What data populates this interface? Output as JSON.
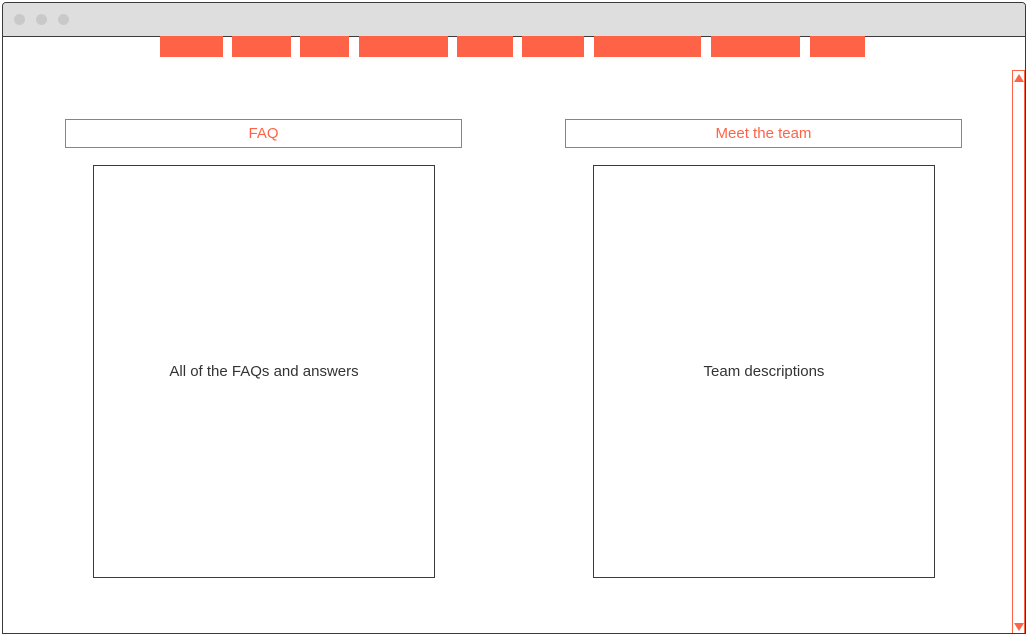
{
  "colors": {
    "accent": "#ff6347",
    "border": "#3a3a3a",
    "titlebar": "#dedede",
    "text": "#333333"
  },
  "nav": {
    "item_count": 9
  },
  "sections": {
    "faq": {
      "title": "FAQ",
      "content": "All of the FAQs and answers"
    },
    "team": {
      "title": "Meet the team",
      "content": "Team descriptions"
    }
  },
  "icons": {
    "scroll_up": "triangle-up",
    "scroll_down": "triangle-down"
  }
}
